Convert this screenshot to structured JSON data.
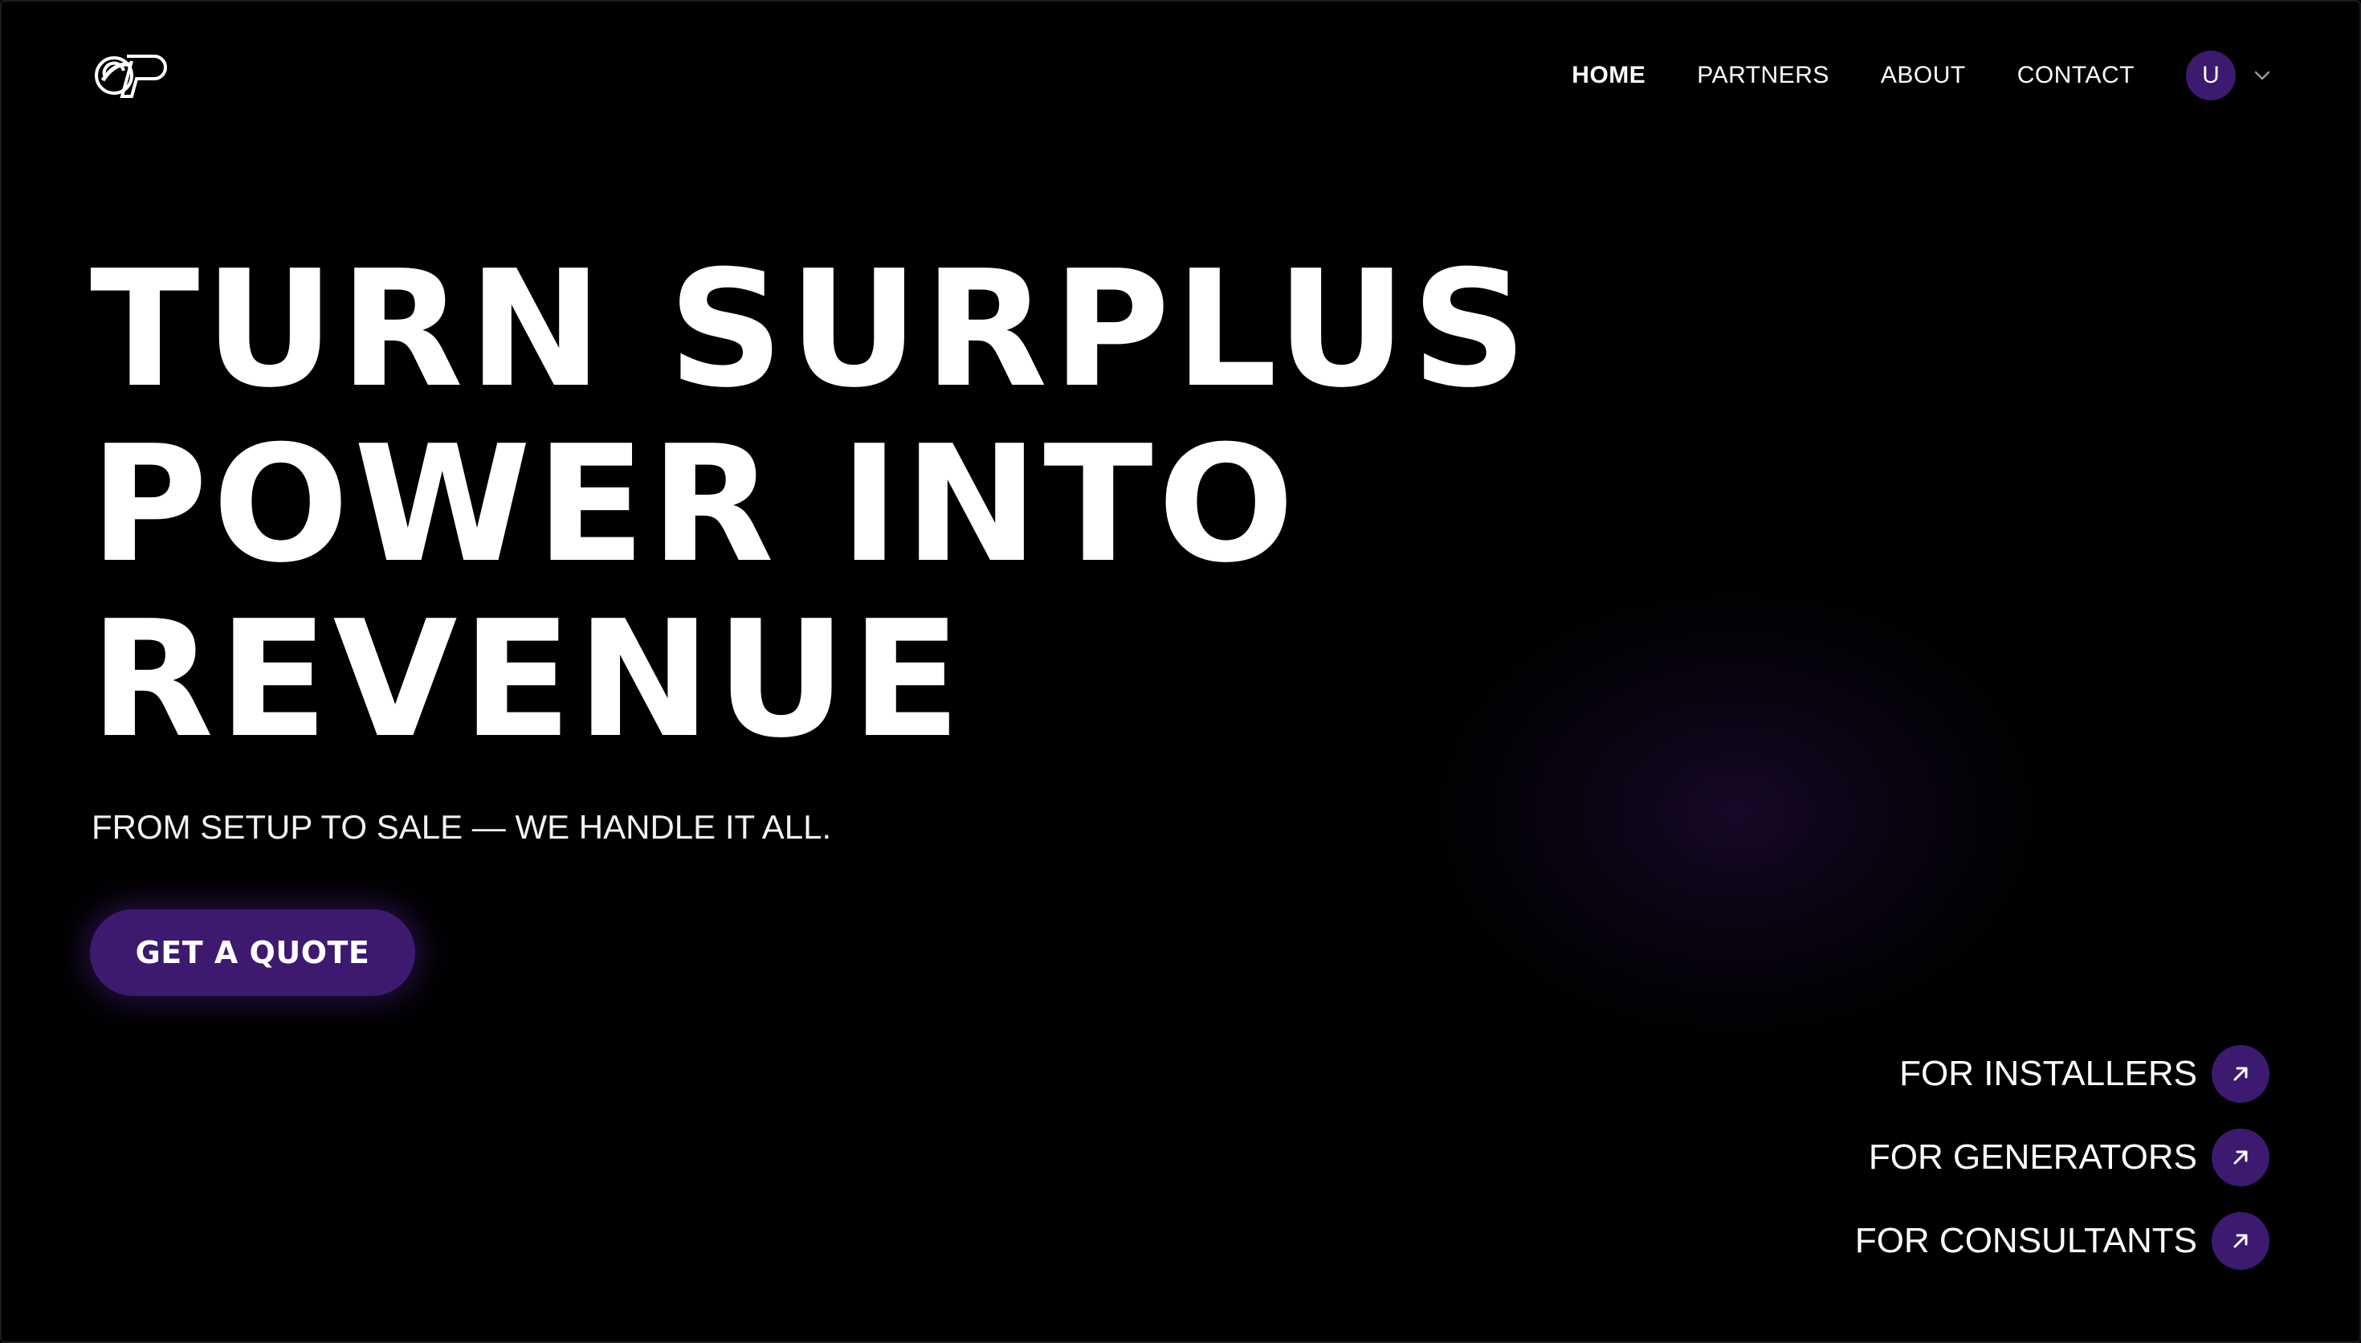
{
  "header": {
    "logo_icon": "op-logo-icon",
    "nav": [
      {
        "label": "HOME",
        "active": true
      },
      {
        "label": "PARTNERS",
        "active": false
      },
      {
        "label": "ABOUT",
        "active": false
      },
      {
        "label": "CONTACT",
        "active": false
      }
    ],
    "user": {
      "initial": "U",
      "menu_icon": "chevron-down-icon"
    }
  },
  "hero": {
    "title_lines": [
      "TURN SURPLUS",
      "POWER INTO",
      "REVENUE"
    ],
    "subtitle": "FROM SETUP TO SALE — WE HANDLE IT ALL.",
    "cta_label": "GET A QUOTE"
  },
  "audience_links": [
    {
      "label": "FOR INSTALLERS",
      "icon": "arrow-up-right-icon"
    },
    {
      "label": "FOR GENERATORS",
      "icon": "arrow-up-right-icon"
    },
    {
      "label": "FOR CONSULTANTS",
      "icon": "arrow-up-right-icon"
    }
  ],
  "colors": {
    "background": "#000000",
    "accent": "#3b1a70",
    "text": "#ffffff"
  }
}
